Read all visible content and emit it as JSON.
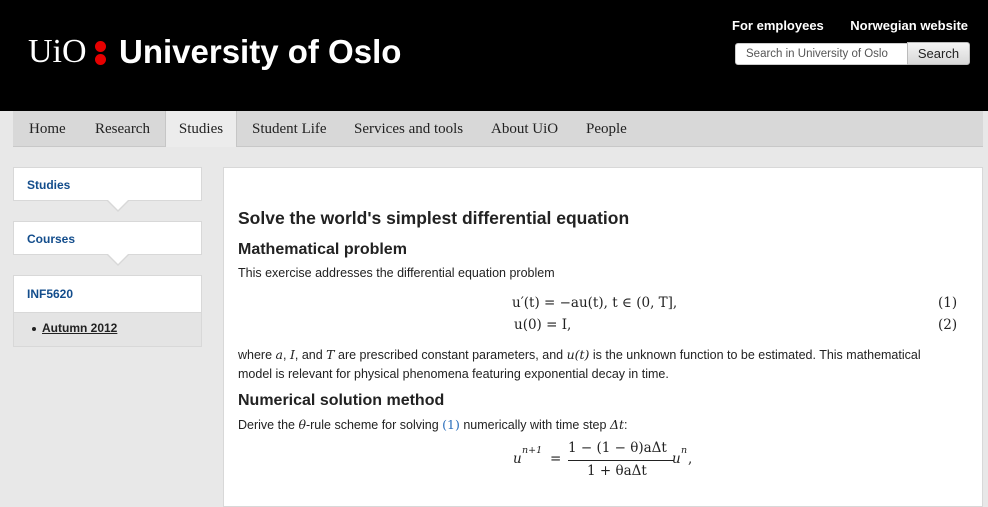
{
  "header": {
    "logo_text": "UiO",
    "university_name": "University of Oslo",
    "links": [
      "For employees",
      "Norwegian website"
    ],
    "search": {
      "placeholder": "Search in University of Oslo",
      "button_label": "Search"
    }
  },
  "nav": {
    "items": [
      "Home",
      "Research",
      "Studies",
      "Student Life",
      "Services and tools",
      "About UiO",
      "People"
    ],
    "active": "Studies"
  },
  "sidebar": {
    "breadcrumbs": [
      "Studies",
      "Courses"
    ],
    "course": "INF5620",
    "semester": "Autumn 2012"
  },
  "content": {
    "title": "Solve the world's simplest differential equation",
    "section1_heading": "Mathematical problem",
    "intro": "This exercise addresses the differential equation problem",
    "eq1": "u′(t) = −au(t),    t ∈ (0, T],",
    "eq1_num": "(1)",
    "eq2": "u(0) = I,",
    "eq2_num": "(2)",
    "para2_line1_a": "where ",
    "var_a": "a",
    "sep1": ", ",
    "var_I": "I",
    "sep2": ", and ",
    "var_T": "T",
    "para2_line1_b": " are prescribed constant parameters, and ",
    "var_ut": "u(t)",
    "para2_line1_c": " is the unknown function to be estimated. This mathematical",
    "para2_line2": "model is relevant for physical phenomena featuring exponential decay in time.",
    "section2_heading": "Numerical solution method",
    "para3_a": "Derive the ",
    "theta": "θ",
    "para3_b": "-rule scheme for solving ",
    "eq_ref": "(1)",
    "para3_c": " numerically with time step ",
    "dt": "Δt",
    "para3_d": ":",
    "scheme_lhs": "u",
    "scheme_lhs_sup": "n+1",
    "scheme_eq": "=",
    "scheme_num": "1 − (1 − θ)aΔt",
    "scheme_den": "1 + θaΔt",
    "scheme_rhs": "u",
    "scheme_rhs_sup": "n",
    "scheme_tail": ","
  }
}
